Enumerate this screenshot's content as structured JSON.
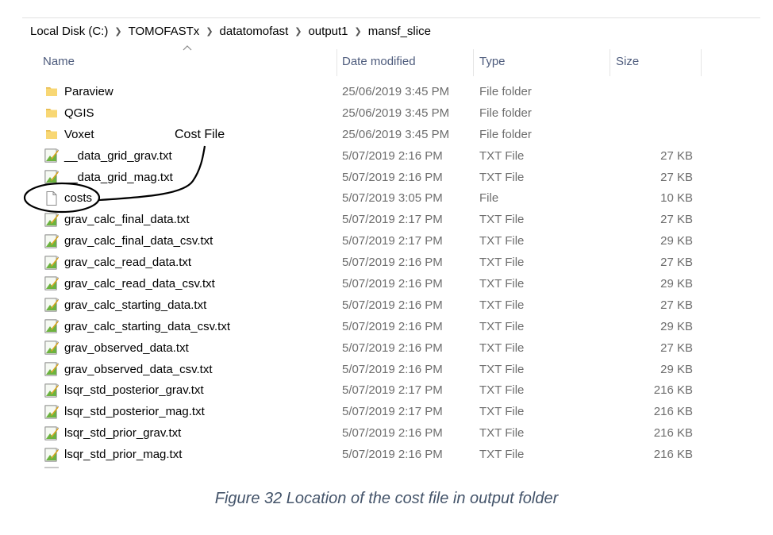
{
  "breadcrumb": [
    "Local Disk (C:)",
    "TOMOFASTx",
    "datatomofast",
    "output1",
    "mansf_slice"
  ],
  "columns": {
    "name": "Name",
    "date": "Date modified",
    "type": "Type",
    "size": "Size"
  },
  "files": [
    {
      "icon": "folder-icon",
      "name": "Paraview",
      "date": "25/06/2019 3:45 PM",
      "type": "File folder",
      "size": ""
    },
    {
      "icon": "folder-icon",
      "name": "QGIS",
      "date": "25/06/2019 3:45 PM",
      "type": "File folder",
      "size": ""
    },
    {
      "icon": "folder-icon",
      "name": "Voxet",
      "date": "25/06/2019 3:45 PM",
      "type": "File folder",
      "size": ""
    },
    {
      "icon": "text-file-icon",
      "name": "__data_grid_grav.txt",
      "date": "5/07/2019 2:16 PM",
      "type": "TXT File",
      "size": "27 KB"
    },
    {
      "icon": "text-file-icon",
      "name": "__data_grid_mag.txt",
      "date": "5/07/2019 2:16 PM",
      "type": "TXT File",
      "size": "27 KB"
    },
    {
      "icon": "blank-file-icon",
      "name": "costs",
      "date": "5/07/2019 3:05 PM",
      "type": "File",
      "size": "10 KB"
    },
    {
      "icon": "text-file-icon",
      "name": "grav_calc_final_data.txt",
      "date": "5/07/2019 2:17 PM",
      "type": "TXT File",
      "size": "27 KB"
    },
    {
      "icon": "text-file-icon",
      "name": "grav_calc_final_data_csv.txt",
      "date": "5/07/2019 2:17 PM",
      "type": "TXT File",
      "size": "29 KB"
    },
    {
      "icon": "text-file-icon",
      "name": "grav_calc_read_data.txt",
      "date": "5/07/2019 2:16 PM",
      "type": "TXT File",
      "size": "27 KB"
    },
    {
      "icon": "text-file-icon",
      "name": "grav_calc_read_data_csv.txt",
      "date": "5/07/2019 2:16 PM",
      "type": "TXT File",
      "size": "29 KB"
    },
    {
      "icon": "text-file-icon",
      "name": "grav_calc_starting_data.txt",
      "date": "5/07/2019 2:16 PM",
      "type": "TXT File",
      "size": "27 KB"
    },
    {
      "icon": "text-file-icon",
      "name": "grav_calc_starting_data_csv.txt",
      "date": "5/07/2019 2:16 PM",
      "type": "TXT File",
      "size": "29 KB"
    },
    {
      "icon": "text-file-icon",
      "name": "grav_observed_data.txt",
      "date": "5/07/2019 2:16 PM",
      "type": "TXT File",
      "size": "27 KB"
    },
    {
      "icon": "text-file-icon",
      "name": "grav_observed_data_csv.txt",
      "date": "5/07/2019 2:16 PM",
      "type": "TXT File",
      "size": "29 KB"
    },
    {
      "icon": "text-file-icon",
      "name": "lsqr_std_posterior_grav.txt",
      "date": "5/07/2019 2:17 PM",
      "type": "TXT File",
      "size": "216 KB"
    },
    {
      "icon": "text-file-icon",
      "name": "lsqr_std_posterior_mag.txt",
      "date": "5/07/2019 2:17 PM",
      "type": "TXT File",
      "size": "216 KB"
    },
    {
      "icon": "text-file-icon",
      "name": "lsqr_std_prior_grav.txt",
      "date": "5/07/2019 2:16 PM",
      "type": "TXT File",
      "size": "216 KB"
    },
    {
      "icon": "text-file-icon",
      "name": "lsqr_std_prior_mag.txt",
      "date": "5/07/2019 2:16 PM",
      "type": "TXT File",
      "size": "216 KB"
    }
  ],
  "annotation": {
    "label": "Cost File"
  },
  "caption": "Figure 32 Location of the cost file in output folder",
  "colors": {
    "folder": "#f8d774",
    "folder_dark": "#e6b84a",
    "caption": "#44546a",
    "header_text": "#4d5b7c",
    "muted_text": "#6d6d6d"
  }
}
